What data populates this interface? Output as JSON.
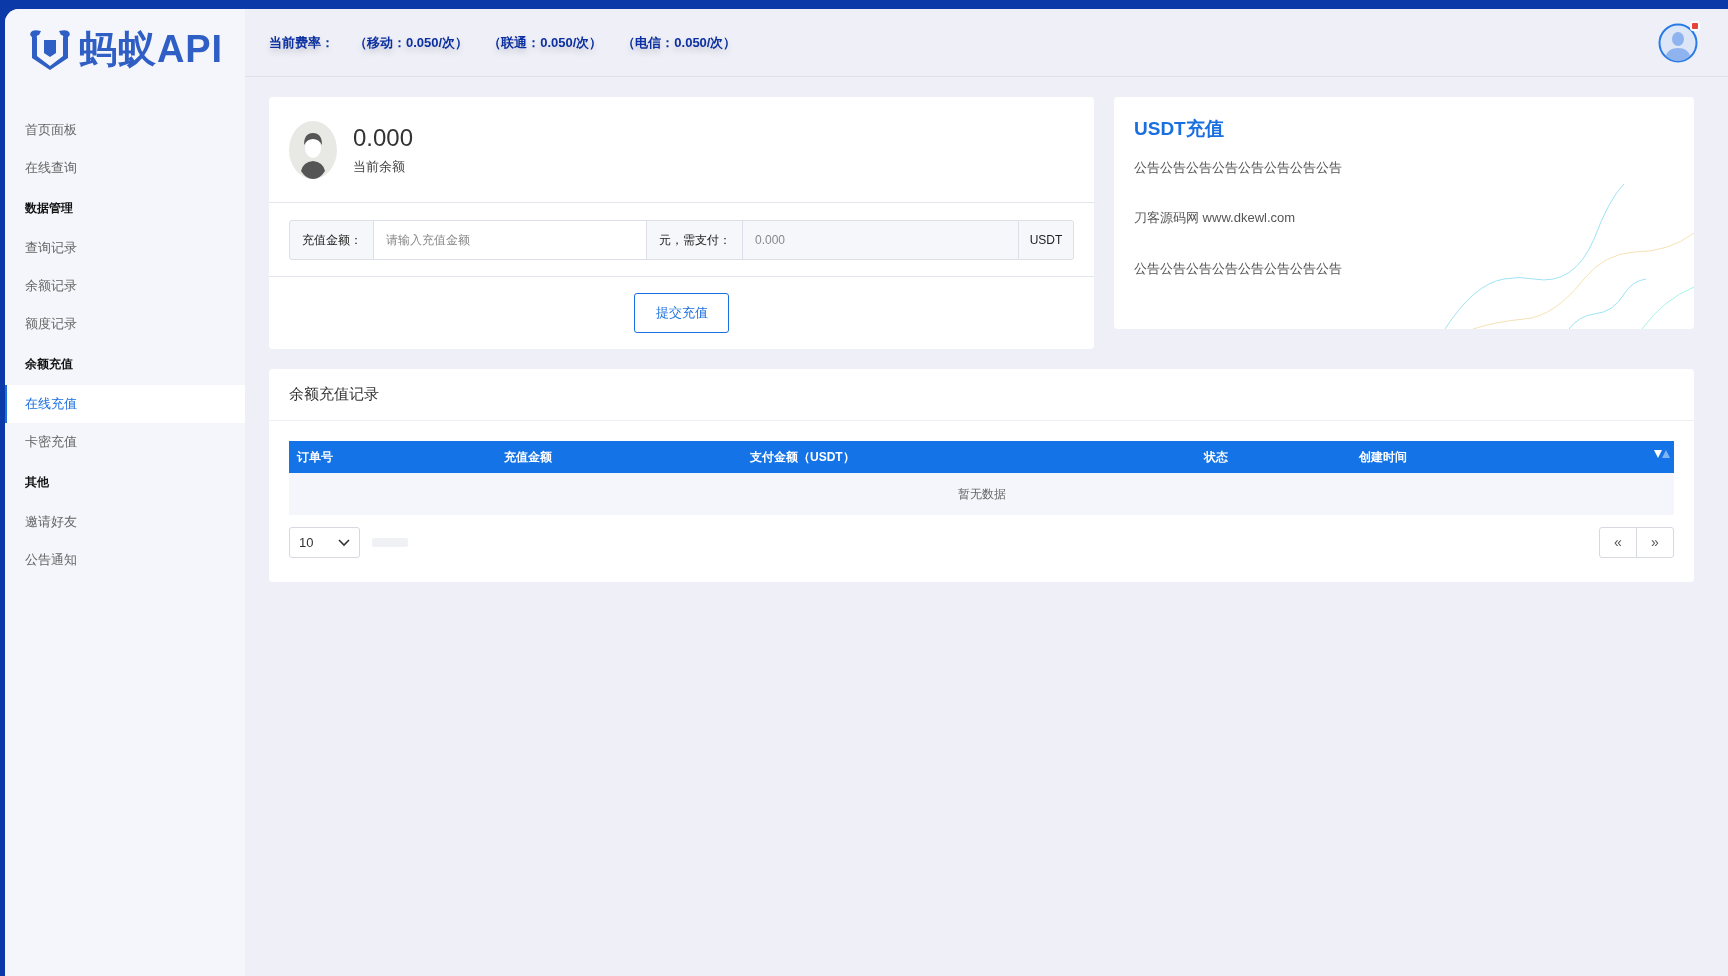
{
  "logo": {
    "text": "蚂蚁API"
  },
  "sidebar": {
    "items": [
      {
        "kind": "link",
        "label": "首页面板",
        "selected": false
      },
      {
        "kind": "link",
        "label": "在线查询",
        "selected": false
      },
      {
        "kind": "heading",
        "label": "数据管理"
      },
      {
        "kind": "link",
        "label": "查询记录",
        "selected": false
      },
      {
        "kind": "link",
        "label": "余额记录",
        "selected": false
      },
      {
        "kind": "link",
        "label": "额度记录",
        "selected": false
      },
      {
        "kind": "heading",
        "label": "余额充值"
      },
      {
        "kind": "link",
        "label": "在线充值",
        "selected": true
      },
      {
        "kind": "link",
        "label": "卡密充值",
        "selected": false
      },
      {
        "kind": "heading",
        "label": "其他"
      },
      {
        "kind": "link",
        "label": "邀请好友",
        "selected": false
      },
      {
        "kind": "link",
        "label": "公告通知",
        "selected": false
      }
    ]
  },
  "header": {
    "rates": [
      "当前费率：",
      "（移动：0.050/次）",
      "（联通：0.050/次）",
      "（电信：0.050/次）"
    ],
    "notification": true
  },
  "balance_card": {
    "amount": "0.000",
    "label": "当前余额",
    "form": {
      "amount_label": "充值金额：",
      "amount_placeholder": "请输入充值金额",
      "pay_label": "元，需支付：",
      "pay_placeholder": "0.000",
      "unit": "USDT"
    },
    "submit": "提交充值"
  },
  "notice_card": {
    "title": "USDT充值",
    "lines": [
      "公告公告公告公告公告公告公告公告",
      "刀客源码网 www.dkewl.com",
      "公告公告公告公告公告公告公告公告"
    ]
  },
  "records": {
    "title": "余额充值记录",
    "table": {
      "columns": [
        "订单号",
        "充值金额",
        "支付金额（USDT）",
        "状态",
        "创建时间"
      ],
      "empty": "暂无数据"
    },
    "page_size": "10",
    "pager": [
      "«",
      "»"
    ]
  }
}
